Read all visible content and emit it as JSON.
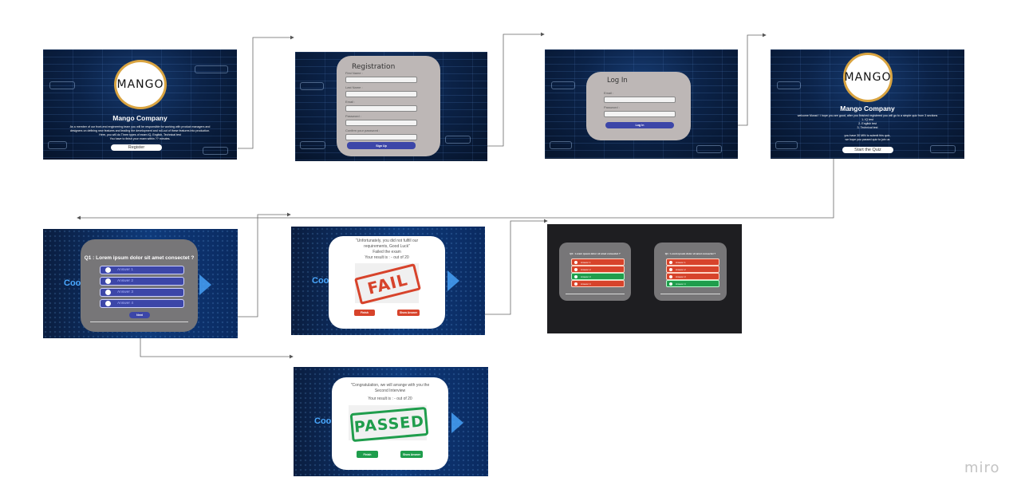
{
  "brand": {
    "watermark": "miro"
  },
  "colors": {
    "accent_blue": "#3c46a8",
    "fail_red": "#d7432b",
    "pass_green": "#1f9d4c",
    "connector": "#555555"
  },
  "welcome": {
    "logo": "MANGO",
    "title": "Mango Company",
    "body": [
      "As a member of our front-end engineering team you will be responsible for working with product managers and",
      "designers on defining new features and leading the development and roll-out of these features into production.",
      "Here, you will do Three types of exam IQ, English, Technical test",
      "You have to finish your exam within ?? minutes."
    ],
    "button": "Register"
  },
  "registration": {
    "title": "Registration",
    "fields": [
      "First Name :",
      "Last Name :",
      "Email :",
      "Password :",
      "Confirm your password :"
    ],
    "button": "Sign Up"
  },
  "login": {
    "title": "Log In",
    "fields": [
      "Email :",
      "Password :"
    ],
    "button": "Log In"
  },
  "intro": {
    "logo": "MANGO",
    "title": "Mango Company",
    "lines": [
      "welcome Murad ! i hope you are good, after you finished registered you will go to a simple quiz from 3 sections",
      "1- IQ test",
      "2- English test",
      "3- Technical test",
      "",
      "you have 30 MIN to submit this quiz,",
      "we hope you passed quiz to join us"
    ],
    "button": "Start the Quiz"
  },
  "question": {
    "title": "Q1 : Lorem ipsum dolor sit amet consectet ?",
    "options": [
      "Answer 1",
      "Answer 2",
      "Answer 3",
      "Answer 4"
    ],
    "button": "Next",
    "bg_text": "Coo"
  },
  "fail": {
    "lines": [
      "\"Unfortunately, you did not fulfill our",
      "requirements, Good Luck\"",
      "Failed the exam",
      "Your result is : - out of 20"
    ],
    "stamp": "FAIL",
    "buttons": [
      "Finish",
      "Show Answer"
    ],
    "bg_text": "Coo"
  },
  "answers": {
    "panels": [
      {
        "title": "Q1 : Lorem ipsum dolor sit amet consectet ?",
        "options": [
          "Answer 1",
          "Answer 2",
          "Answer 3",
          "Answer 4"
        ],
        "correct": 2
      },
      {
        "title": "Q1 : Lorem ipsum dolor sit amet consectet ?",
        "options": [
          "Answer 1",
          "Answer 2",
          "Answer 3",
          "Answer 4"
        ],
        "correct": 3
      }
    ]
  },
  "pass": {
    "lines": [
      "\"Congratulation, we will arrange with you the",
      "Second Interview",
      "",
      "Your result is : - out of 20"
    ],
    "stamp": "PASSED",
    "buttons": [
      "Finish",
      "Show Answer"
    ],
    "bg_text": "Coo"
  }
}
